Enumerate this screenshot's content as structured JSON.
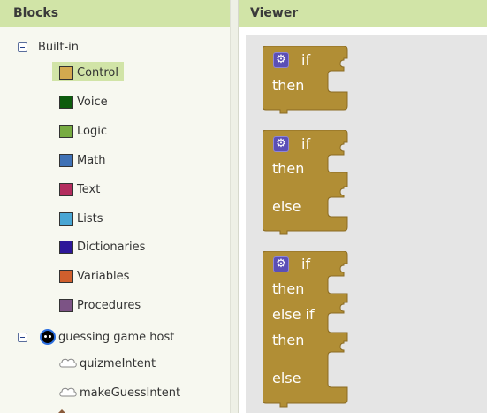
{
  "blocks_panel": {
    "title": "Blocks",
    "builtin_label": "Built-in",
    "categories": [
      {
        "label": "Control",
        "color": "#d3a94f"
      },
      {
        "label": "Voice",
        "color": "#0d5c0d"
      },
      {
        "label": "Logic",
        "color": "#77ab41"
      },
      {
        "label": "Math",
        "color": "#3f71b5"
      },
      {
        "label": "Text",
        "color": "#b32d5e"
      },
      {
        "label": "Lists",
        "color": "#49a6d4"
      },
      {
        "label": "Dictionaries",
        "color": "#2d1799"
      },
      {
        "label": "Variables",
        "color": "#d05f2d"
      },
      {
        "label": "Procedures",
        "color": "#7c5385"
      }
    ],
    "agent_label": "guessing game host",
    "intents": [
      "quizmeIntent",
      "makeGuessIntent"
    ]
  },
  "viewer": {
    "title": "Viewer",
    "block_color": "#b18e35",
    "blocks": [
      {
        "kw_if": "if",
        "kw_then": "then"
      },
      {
        "kw_if": "if",
        "kw_then": "then",
        "kw_else": "else"
      },
      {
        "kw_if": "if",
        "kw_then": "then",
        "kw_elseif": "else if",
        "kw_then2": "then",
        "kw_else": "else"
      }
    ]
  }
}
